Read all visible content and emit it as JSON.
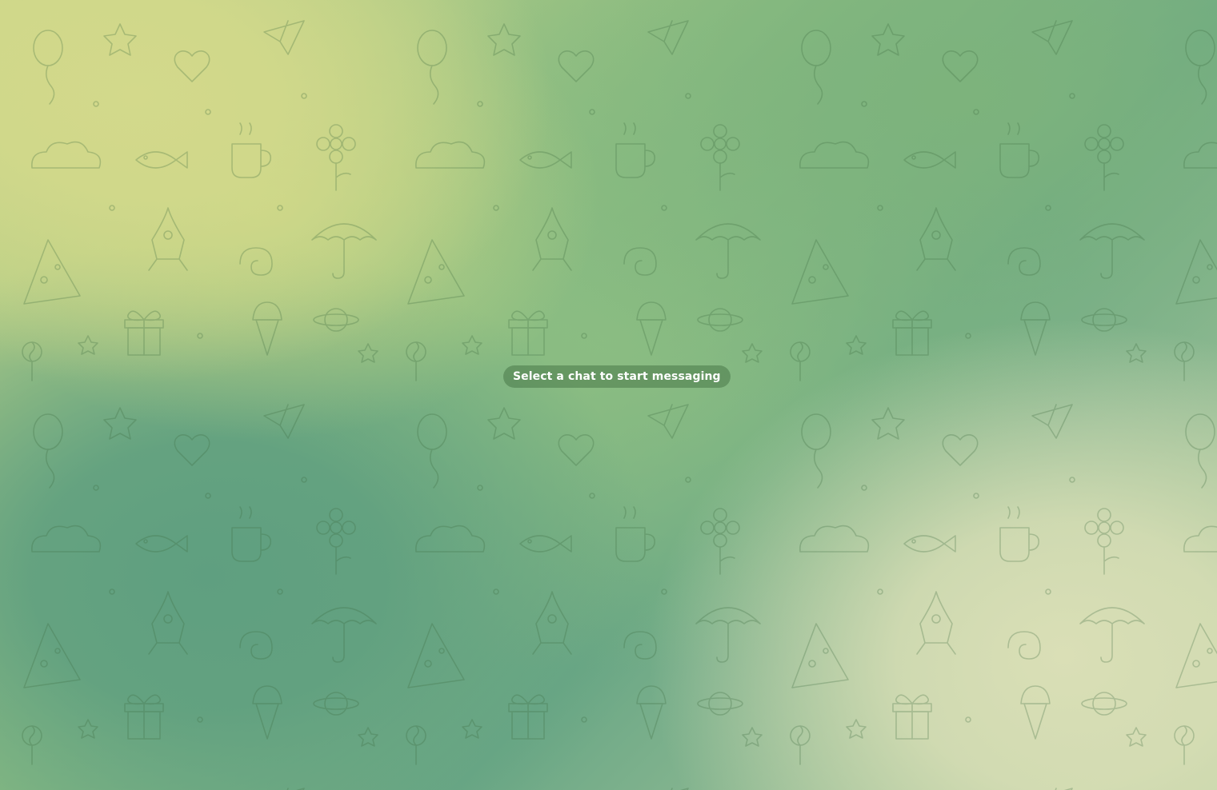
{
  "chat_area": {
    "background_colors": [
      "#d3d98b",
      "#8fbf83",
      "#5f9f80",
      "#dadfb6"
    ],
    "pattern_color": "#3d6b3f",
    "placeholder_text": "Select a chat to start messaging",
    "placeholder_bg": "#487848"
  }
}
